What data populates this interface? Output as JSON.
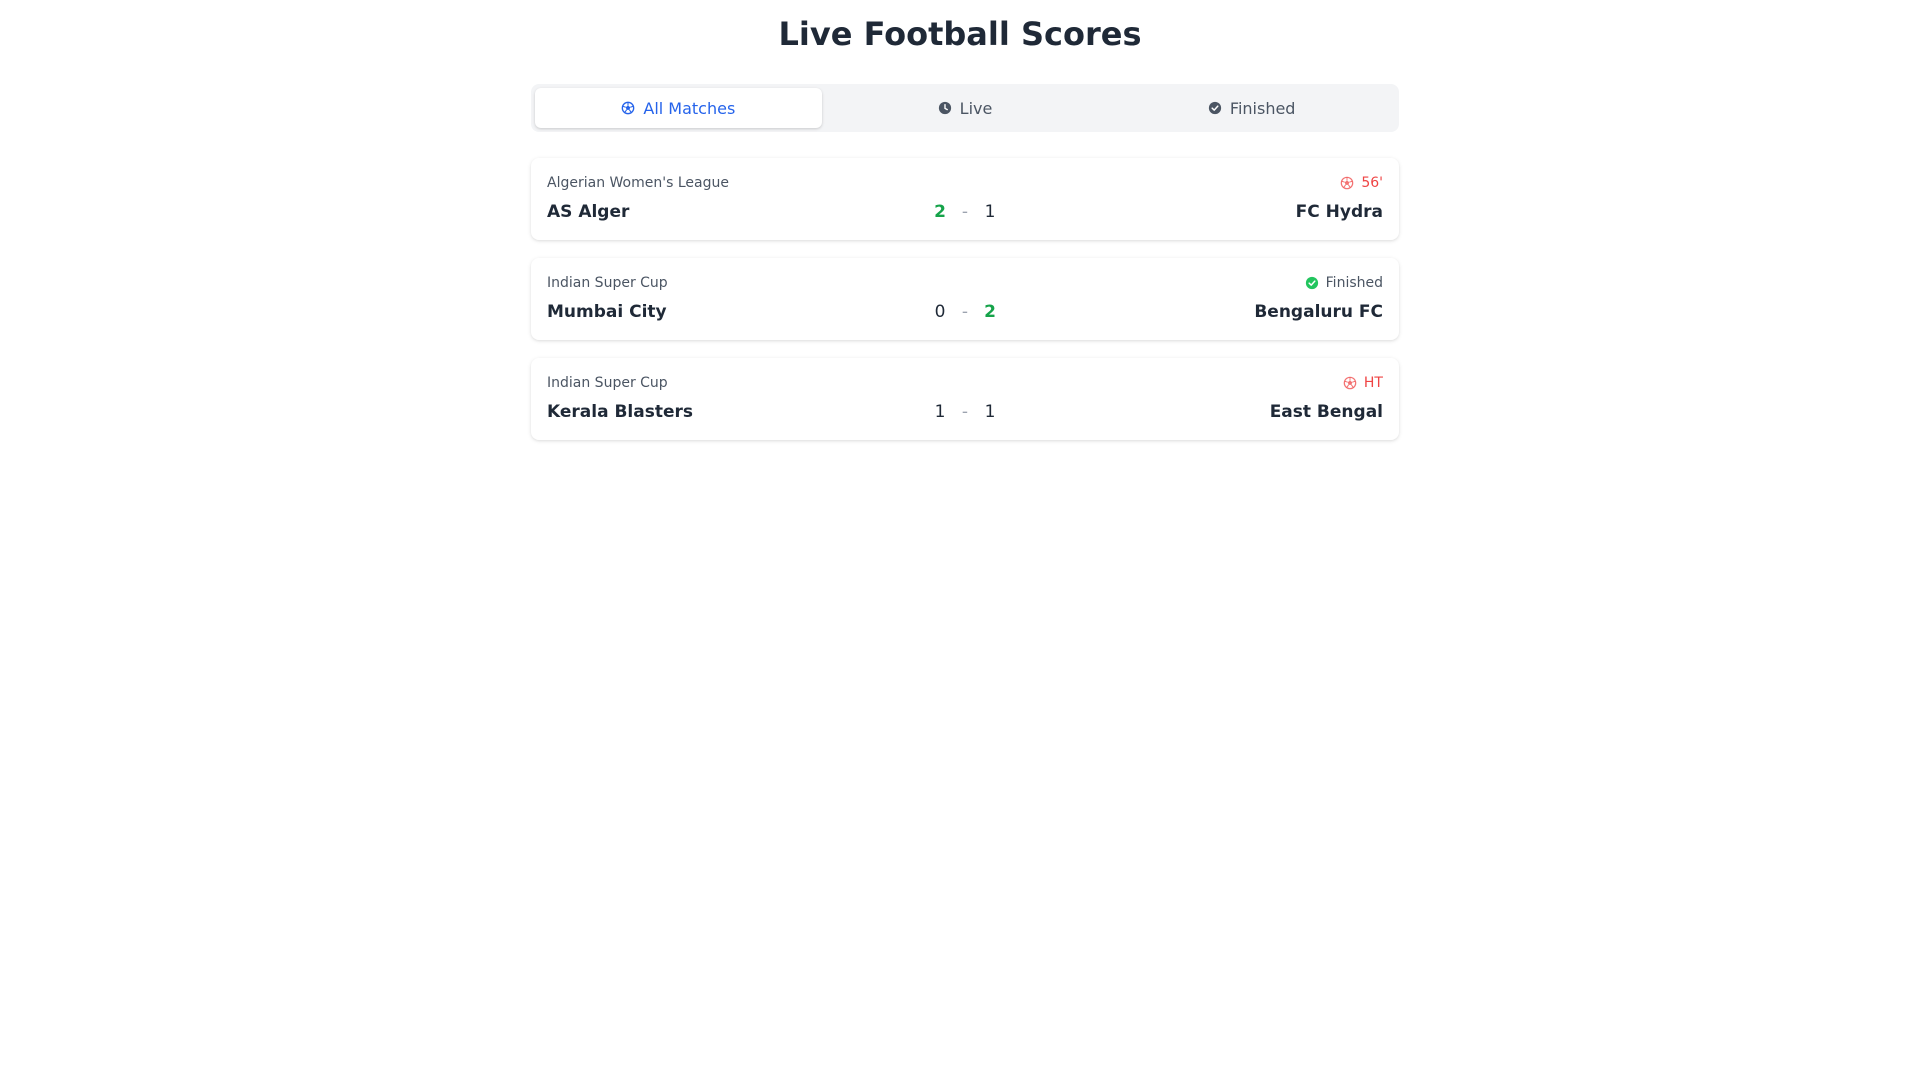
{
  "title": "Live Football Scores",
  "tabs": [
    {
      "label": "All Matches",
      "icon": "soccer-ball-icon",
      "active": true
    },
    {
      "label": "Live",
      "icon": "clock-icon",
      "active": false
    },
    {
      "label": "Finished",
      "icon": "check-circle-icon",
      "active": false
    }
  ],
  "matches": [
    {
      "league": "Algerian Women's League",
      "status": "56'",
      "status_type": "live",
      "status_icon": "soccer-ball-icon",
      "home": "AS Alger",
      "home_score": "2",
      "separator": "-",
      "away_score": "1",
      "away": "FC Hydra"
    },
    {
      "league": "Indian Super Cup",
      "status": "Finished",
      "status_type": "finished",
      "status_icon": "check-circle-icon",
      "home": "Mumbai City",
      "home_score": "0",
      "separator": "-",
      "away_score": "2",
      "away": "Bengaluru FC"
    },
    {
      "league": "Indian Super Cup",
      "status": "HT",
      "status_type": "live",
      "status_icon": "soccer-ball-icon",
      "home": "Kerala Blasters",
      "home_score": "1",
      "separator": "-",
      "away_score": "1",
      "away": "East Bengal"
    }
  ],
  "colors": {
    "accent": "#2563eb",
    "live": "#ef4444",
    "finished_check": "#22c55e",
    "winning_score": "#16a34a"
  }
}
